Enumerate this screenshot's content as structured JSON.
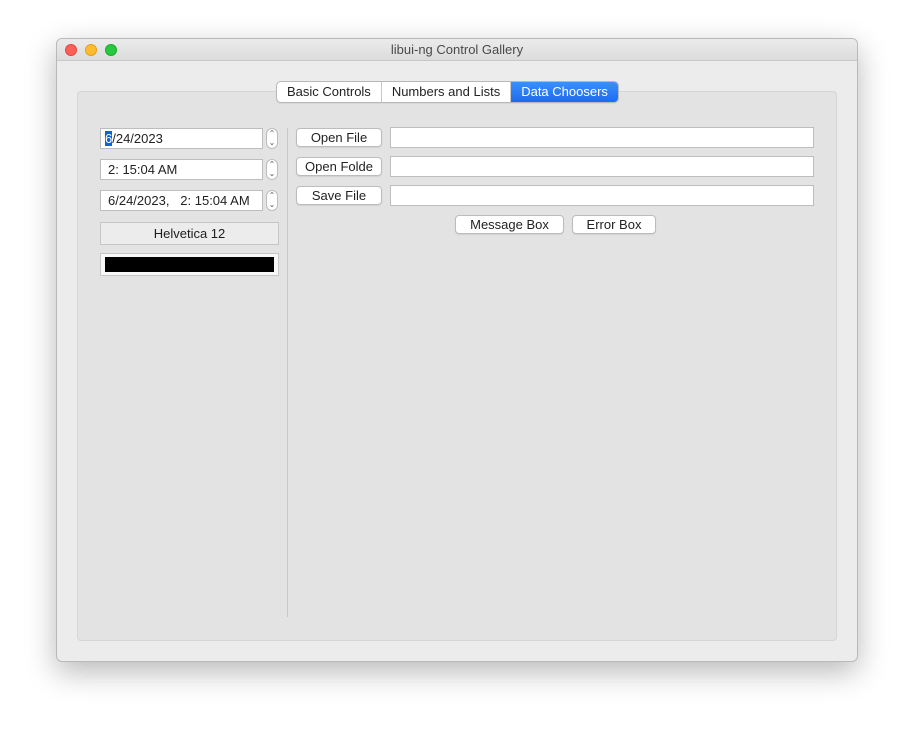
{
  "window": {
    "title": "libui-ng Control Gallery"
  },
  "tabs": [
    {
      "label": "Basic Controls",
      "active": false
    },
    {
      "label": "Numbers and Lists",
      "active": false
    },
    {
      "label": "Data Choosers",
      "active": true
    }
  ],
  "left": {
    "date_picker": {
      "selected_segment": "6",
      "rest": "/24/2023"
    },
    "time_picker": {
      "value": "2: 15:04 AM"
    },
    "datetime_picker": {
      "value": "6/24/2023,   2: 15:04 AM"
    },
    "font_button": {
      "label": "Helvetica 12"
    },
    "color_button": {
      "color": "#000000"
    }
  },
  "right": {
    "open_file_button": {
      "label": "Open File"
    },
    "open_file_entry": {
      "value": ""
    },
    "open_folder_button": {
      "label": "Open Folde"
    },
    "open_folder_entry": {
      "value": ""
    },
    "save_file_button": {
      "label": "Save File"
    },
    "save_file_entry": {
      "value": ""
    },
    "message_box_button": {
      "label": "Message Box"
    },
    "error_box_button": {
      "label": "Error Box"
    }
  },
  "colors": {
    "accent": "#1a6cf0",
    "selection": "#1160df"
  }
}
